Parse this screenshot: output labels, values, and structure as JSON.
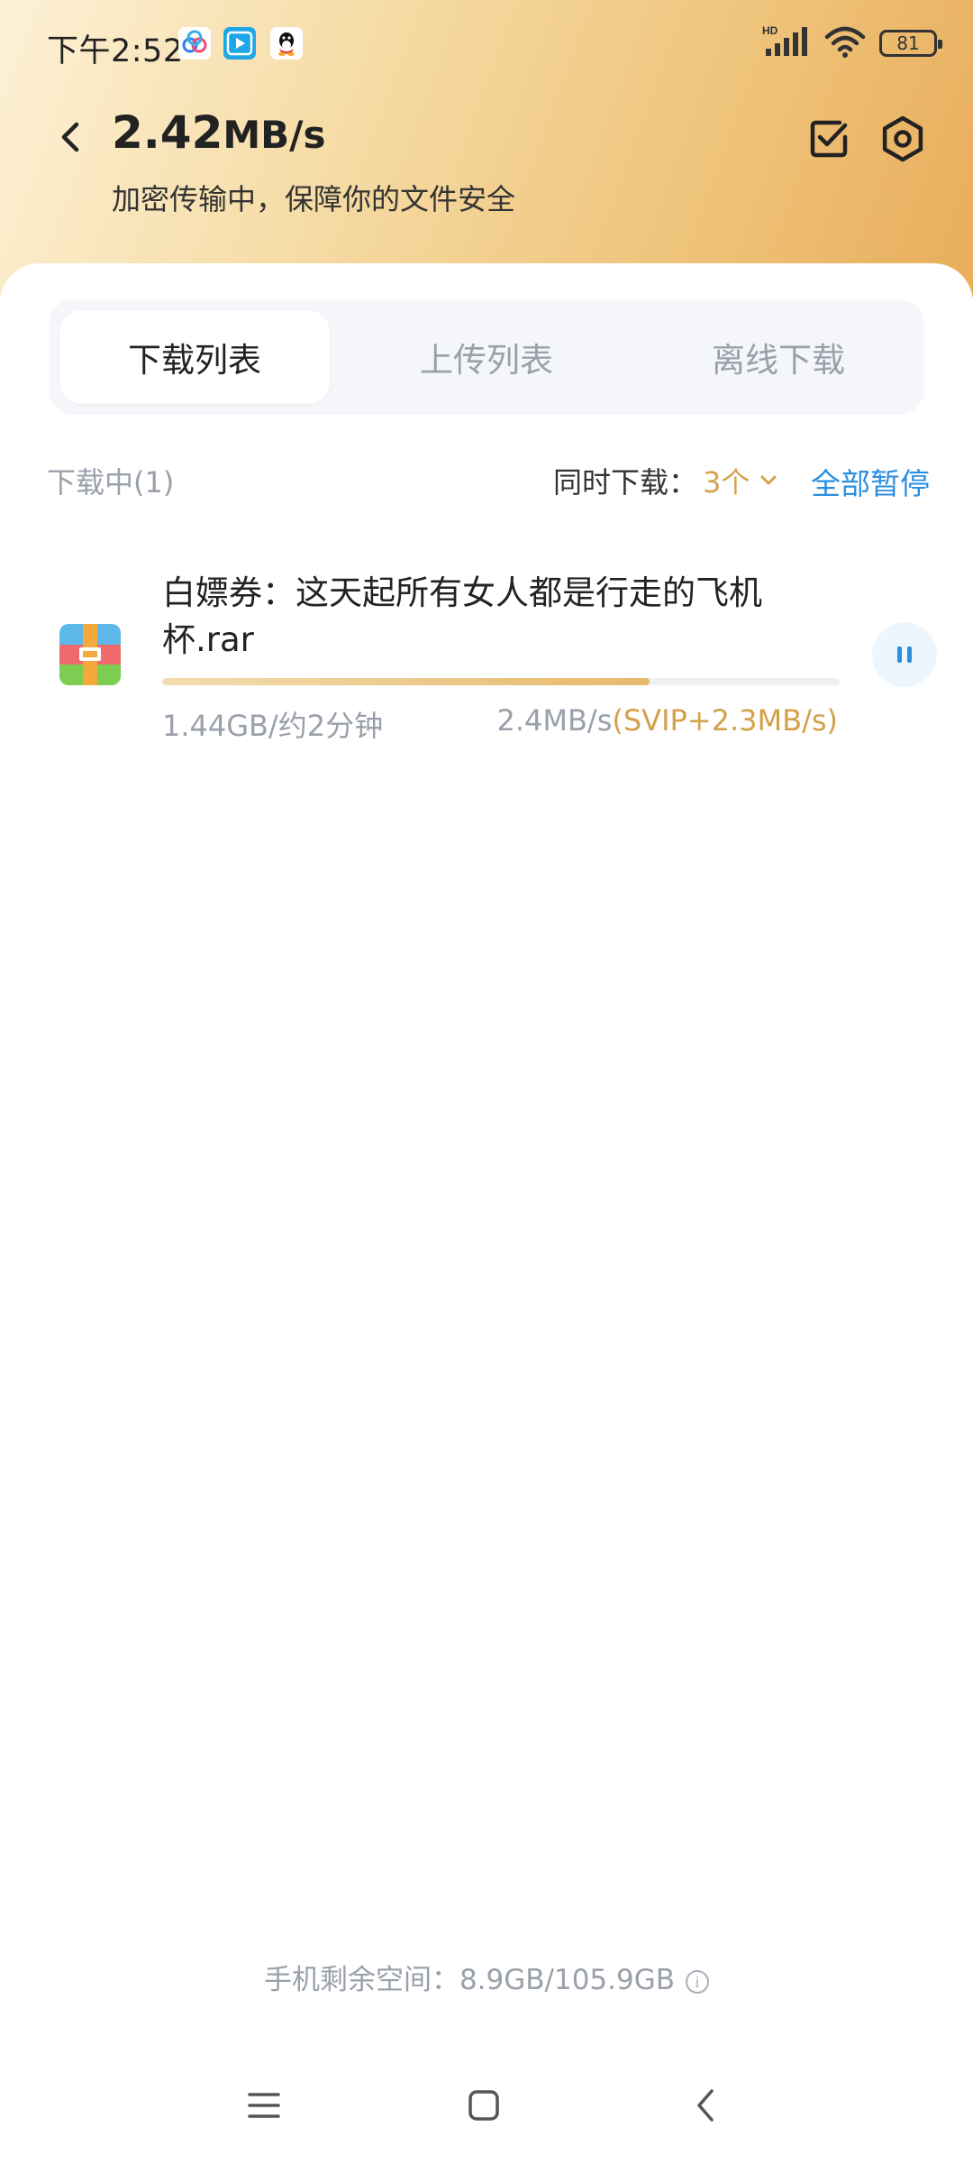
{
  "status_bar": {
    "time": "下午2:52",
    "network_label": "HD",
    "battery": "81"
  },
  "header": {
    "speed_value": "2.42",
    "speed_unit": "MB/s",
    "subtitle": "加密传输中，保障你的文件安全"
  },
  "tabs": [
    {
      "label": "下载列表",
      "active": true
    },
    {
      "label": "上传列表",
      "active": false
    },
    {
      "label": "离线下载",
      "active": false
    }
  ],
  "downloads": {
    "count_label": "下载中(1)",
    "concurrent_label": "同时下载：",
    "concurrent_value": "3个",
    "pause_all_label": "全部暂停",
    "items": [
      {
        "name": "白嫖券：这天起所有女人都是行走的飞机杯.rar",
        "size_eta": "1.44GB/约2分钟",
        "speed": "2.4MB/s",
        "vip_speed": "(SVIP+2.3MB/s)",
        "progress_pct": 72
      }
    ]
  },
  "footer": {
    "storage": "手机剩余空间：8.9GB/105.9GB",
    "info_glyph": "i"
  },
  "colors": {
    "accent_blue": "#2b8fe0",
    "vip_gold": "#d4a04a",
    "header_gradient_start": "#fdf1d6",
    "header_gradient_end": "#e8ad5b"
  }
}
